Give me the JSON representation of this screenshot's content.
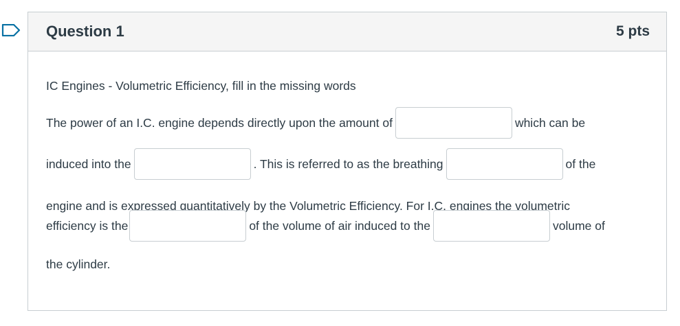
{
  "question": {
    "title": "Question 1",
    "points": "5 pts",
    "intro": "IC Engines - Volumetric Efficiency, fill in the missing words",
    "segments": {
      "s1": "The power of an I.C. engine depends directly upon the amount of",
      "s2": "which can be",
      "s3": "induced into the",
      "s4": ". This is referred to as the breathing",
      "s5": "of the",
      "s6": "engine and is expressed quantitatively by the Volumetric Efficiency. For I.C. engines the volumetric",
      "s7": "efficiency is the",
      "s8": "of the volume of air induced to the",
      "s9": "volume of",
      "s10": "the cylinder."
    },
    "blanks": {
      "b1": "",
      "b2": "",
      "b3": "",
      "b4": "",
      "b5": ""
    }
  }
}
